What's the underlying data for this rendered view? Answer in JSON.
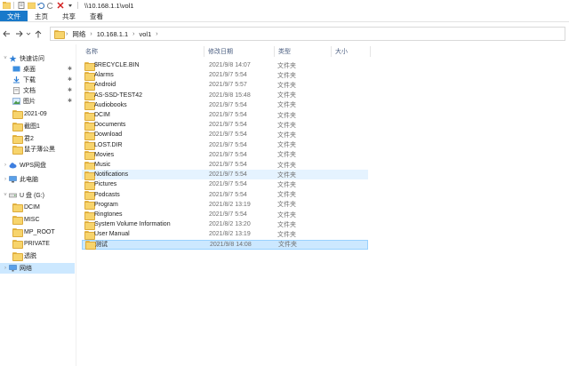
{
  "titlebar": {
    "path": "\\\\10.168.1.1\\vol1"
  },
  "ribbon": {
    "tabs": [
      "文件",
      "主页",
      "共享",
      "查看"
    ]
  },
  "address": {
    "crumbs": [
      "网络",
      "10.168.1.1",
      "vol1"
    ]
  },
  "columns": {
    "name": "名称",
    "date": "修改日期",
    "type": "类型",
    "size": "大小"
  },
  "navpane": {
    "quick_access": "快速访问",
    "quick_items": [
      {
        "label": "桌面",
        "pinned": true
      },
      {
        "label": "下载",
        "pinned": true
      },
      {
        "label": "文档",
        "pinned": true
      },
      {
        "label": "图片",
        "pinned": true
      },
      {
        "label": "2021-09",
        "pinned": false
      },
      {
        "label": "截图1",
        "pinned": false
      },
      {
        "label": "君2",
        "pinned": false
      },
      {
        "label": "鼠子薄公黑",
        "pinned": false
      }
    ],
    "wps": "WPS网盘",
    "this_pc": "此电脑",
    "drive": "U 盘 (G:)",
    "drive_items": [
      "DCIM",
      "MISC",
      "MP_ROOT",
      "PRIVATE",
      "透脱"
    ],
    "network": "网络"
  },
  "files": [
    {
      "name": "$RECYCLE.BIN",
      "date": "2021/9/8 14:07",
      "type": "文件夹"
    },
    {
      "name": "Alarms",
      "date": "2021/9/7 5:54",
      "type": "文件夹"
    },
    {
      "name": "Android",
      "date": "2021/9/7 5:57",
      "type": "文件夹"
    },
    {
      "name": "AS-SSD-TEST42",
      "date": "2021/9/8 15:48",
      "type": "文件夹"
    },
    {
      "name": "Audiobooks",
      "date": "2021/9/7 5:54",
      "type": "文件夹"
    },
    {
      "name": "DCIM",
      "date": "2021/9/7 5:54",
      "type": "文件夹"
    },
    {
      "name": "Documents",
      "date": "2021/9/7 5:54",
      "type": "文件夹"
    },
    {
      "name": "Download",
      "date": "2021/9/7 5:54",
      "type": "文件夹"
    },
    {
      "name": "LOST.DIR",
      "date": "2021/9/7 5:54",
      "type": "文件夹"
    },
    {
      "name": "Movies",
      "date": "2021/9/7 5:54",
      "type": "文件夹"
    },
    {
      "name": "Music",
      "date": "2021/9/7 5:54",
      "type": "文件夹"
    },
    {
      "name": "Notifications",
      "date": "2021/9/7 5:54",
      "type": "文件夹"
    },
    {
      "name": "Pictures",
      "date": "2021/9/7 5:54",
      "type": "文件夹"
    },
    {
      "name": "Podcasts",
      "date": "2021/9/7 5:54",
      "type": "文件夹"
    },
    {
      "name": "Program",
      "date": "2021/8/2 13:19",
      "type": "文件夹"
    },
    {
      "name": "Ringtones",
      "date": "2021/9/7 5:54",
      "type": "文件夹"
    },
    {
      "name": "System Volume Information",
      "date": "2021/8/2 13:20",
      "type": "文件夹"
    },
    {
      "name": "User Manual",
      "date": "2021/8/2 13:19",
      "type": "文件夹"
    },
    {
      "name": "测试",
      "date": "2021/9/8 14:08",
      "type": "文件夹"
    }
  ]
}
